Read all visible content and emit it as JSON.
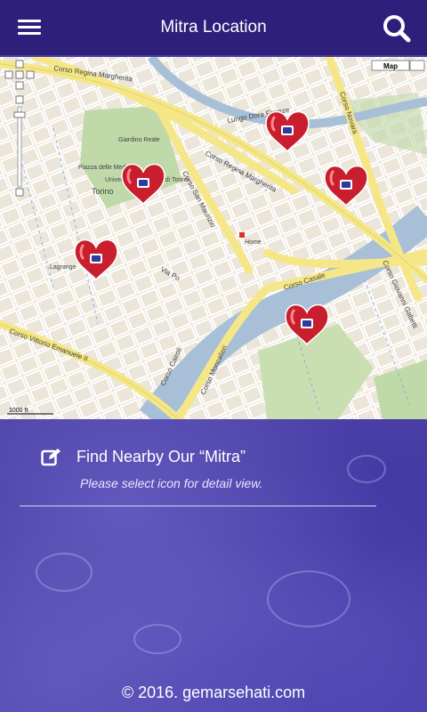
{
  "header": {
    "title": "Mitra Location",
    "menu_icon": "hamburger-menu-icon",
    "search_icon": "search-icon"
  },
  "map": {
    "type_button": "Map",
    "scale_label": "1000 ft",
    "place_labels": {
      "torino": "Torino",
      "universita": "Università degli Studi di Torino",
      "home": "Home",
      "piazza": "Piazza delle Medaglie",
      "giardino": "Giardino Reale",
      "lagrange": "Lagrange"
    },
    "street_labels": {
      "regina1": "Corso Regina Margherita",
      "regina2": "Corso Regina Margherita",
      "san_maurizio": "Corso San Maurizio",
      "cairoli": "Corso Cairoli",
      "moncalieri": "Corso Moncalieri",
      "casale": "Corso Casale",
      "gabetti": "Corso Giovanni Gabetti",
      "vittorio": "Corso Vittorio Emanuele II",
      "novara": "Corso Novara",
      "dora_firenze": "Lungo Dora Firenze",
      "po": "Via Po"
    },
    "marker_icon": "heart-location-marker-icon"
  },
  "content": {
    "find_title": "Find Nearby Our “Mitra”",
    "find_subtitle": "Please select icon for detail view.",
    "edit_icon": "edit-icon"
  },
  "footer": {
    "copyright": "© 2016. gemarsehati.com"
  }
}
